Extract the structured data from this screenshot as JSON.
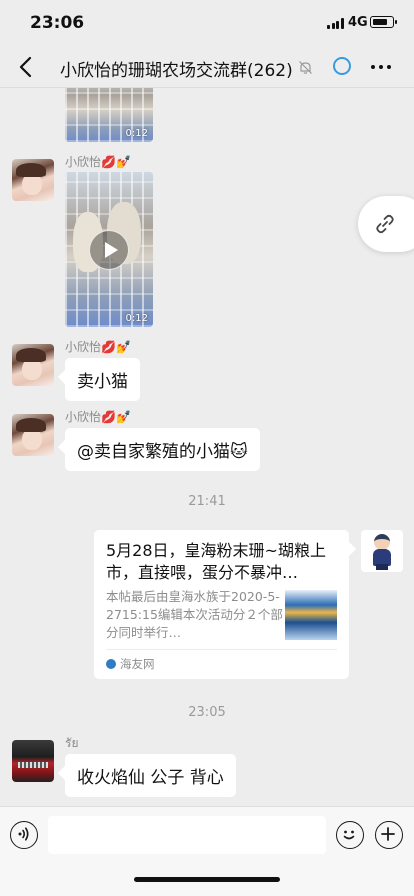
{
  "status_bar": {
    "time": "23:06",
    "network": "4G",
    "battery_level": 0.8,
    "icons": [
      "signal-icon",
      "battery-icon"
    ]
  },
  "nav": {
    "back_icon": "chevron-left-icon",
    "title": "小欣怡的珊瑚农场交流群(262)",
    "mute_icon": "bell-off-icon",
    "status_icon": "ring-icon",
    "more_icon": "more-icon"
  },
  "messages": [
    {
      "type": "video",
      "duration": "0:12"
    },
    {
      "type": "video",
      "sender": "小欣怡💋💅",
      "duration": "0:12"
    },
    {
      "type": "text",
      "sender": "小欣怡💋💅",
      "text": "卖小猫"
    },
    {
      "type": "text",
      "sender": "小欣怡💋💅",
      "text": "@卖自家繁殖的小猫🐱"
    },
    {
      "type": "time",
      "text": "21:41"
    },
    {
      "type": "link",
      "title": "5月28日，皇海粉末珊~瑚粮上市，直接喂，蛋分不暴冲…",
      "desc": "本帖最后由皇海水族于2020-5-2715:15编辑本次活动分２个部分同时举行…",
      "source": "海友网"
    },
    {
      "type": "time",
      "text": "23:05"
    },
    {
      "type": "text",
      "sender": "รัย",
      "text": "收火焰仙 公子 背心"
    }
  ],
  "floating_button": {
    "icon": "link-icon"
  },
  "input_bar": {
    "voice_icon": "voice-icon",
    "input_value": "",
    "emoji_icon": "emoji-icon",
    "plus_icon": "plus-icon"
  }
}
